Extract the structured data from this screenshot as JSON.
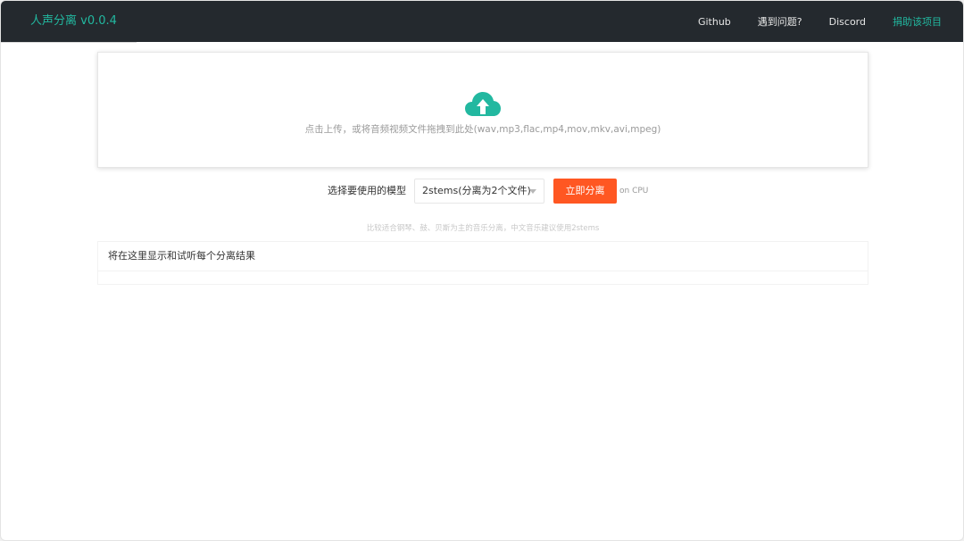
{
  "navbar": {
    "brand": "人声分离 v0.0.4",
    "links": [
      {
        "label": "Github"
      },
      {
        "label": "遇到问题?"
      },
      {
        "label": "Discord"
      },
      {
        "label": "捐助该项目"
      }
    ]
  },
  "upload": {
    "icon": "cloud-upload-icon",
    "hint": "点击上传，或将音频视频文件拖拽到此处(wav,mp3,flac,mp4,mov,mkv,avi,mpeg)"
  },
  "controls": {
    "model_label": "选择要使用的模型",
    "model_selected": "2stems(分离为2个文件)",
    "separate_button": "立即分离",
    "device": "on CPU",
    "tip": "比较适合钢琴、鼓、贝斯为主的音乐分离，中文音乐建议使用2stems"
  },
  "results": {
    "title": "将在这里显示和试听每个分离结果"
  },
  "colors": {
    "navbar_bg": "#24292e",
    "brand": "#22b8a0",
    "button": "#ff5722",
    "icon": "#22b8a0"
  }
}
